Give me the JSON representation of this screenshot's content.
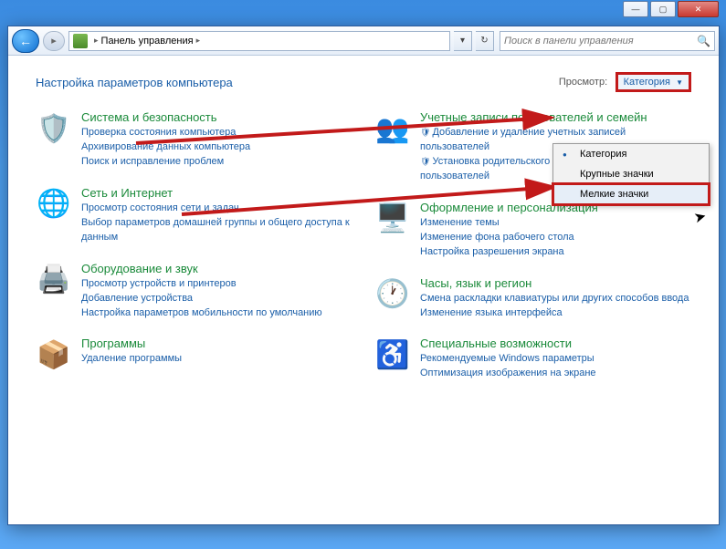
{
  "window": {
    "breadcrumb_root": "Панель управления",
    "search_placeholder": "Поиск в панели управления"
  },
  "page": {
    "heading": "Настройка параметров компьютера",
    "view_label": "Просмотр:",
    "view_value": "Категория"
  },
  "view_menu": {
    "opt_category": "Категория",
    "opt_large": "Крупные значки",
    "opt_small": "Мелкие значки"
  },
  "left": [
    {
      "title": "Система и безопасность",
      "links": [
        {
          "text": "Проверка состояния компьютера"
        },
        {
          "text": "Архивирование данных компьютера"
        },
        {
          "text": "Поиск и исправление проблем"
        }
      ]
    },
    {
      "title": "Сеть и Интернет",
      "links": [
        {
          "text": "Просмотр состояния сети и задач"
        },
        {
          "text": "Выбор параметров домашней группы и общего доступа к данным"
        }
      ]
    },
    {
      "title": "Оборудование и звук",
      "links": [
        {
          "text": "Просмотр устройств и принтеров"
        },
        {
          "text": "Добавление устройства"
        },
        {
          "text": "Настройка параметров мобильности по умолчанию"
        }
      ]
    },
    {
      "title": "Программы",
      "links": [
        {
          "text": "Удаление программы"
        }
      ]
    }
  ],
  "right": [
    {
      "title": "Учетные записи пользователей и семейн",
      "links": [
        {
          "text": "Добавление и удаление учетных записей пользователей",
          "shield": true
        },
        {
          "text": "Установка родительского контроля для всех пользователей",
          "shield": true
        }
      ]
    },
    {
      "title": "Оформление и персонализация",
      "links": [
        {
          "text": "Изменение темы"
        },
        {
          "text": "Изменение фона рабочего стола"
        },
        {
          "text": "Настройка разрешения экрана"
        }
      ]
    },
    {
      "title": "Часы, язык и регион",
      "links": [
        {
          "text": "Смена раскладки клавиатуры или других способов ввода"
        },
        {
          "text": "Изменение языка интерфейса"
        }
      ]
    },
    {
      "title": "Специальные возможности",
      "links": [
        {
          "text": "Рекомендуемые Windows параметры"
        },
        {
          "text": "Оптимизация изображения на экране"
        }
      ]
    }
  ],
  "icons": {
    "left": [
      "🛡️",
      "🌐",
      "🖨️",
      "📦"
    ],
    "right": [
      "👥",
      "🖥️",
      "🕐",
      "♿"
    ]
  }
}
